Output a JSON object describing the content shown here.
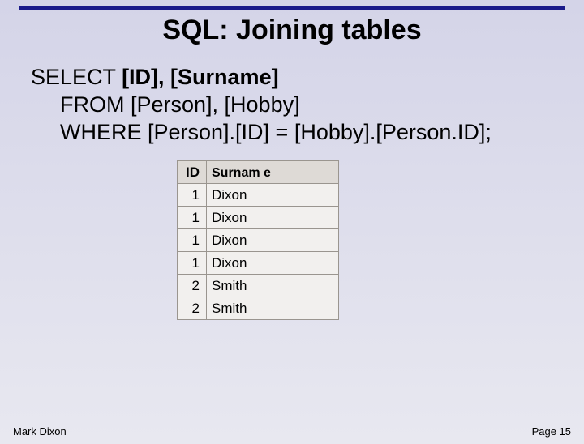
{
  "title": "SQL: Joining tables",
  "sql": {
    "line1_kw": "SELECT ",
    "line1_rest": "[ID], [Surname]",
    "line2": "FROM [Person], [Hobby]",
    "line3": "WHERE [Person].[ID] = [Hobby].[Person.ID];"
  },
  "table": {
    "headers": {
      "id": "ID",
      "surname": "Surnam\ne"
    },
    "rows": [
      {
        "id": "1",
        "surname": "Dixon"
      },
      {
        "id": "1",
        "surname": "Dixon"
      },
      {
        "id": "1",
        "surname": "Dixon"
      },
      {
        "id": "1",
        "surname": "Dixon"
      },
      {
        "id": "2",
        "surname": "Smith"
      },
      {
        "id": "2",
        "surname": "Smith"
      }
    ]
  },
  "footer": {
    "author": "Mark Dixon",
    "page": "Page 15"
  },
  "chart_data": {
    "type": "table",
    "title": "SQL join result",
    "columns": [
      "ID",
      "Surname"
    ],
    "rows": [
      [
        1,
        "Dixon"
      ],
      [
        1,
        "Dixon"
      ],
      [
        1,
        "Dixon"
      ],
      [
        1,
        "Dixon"
      ],
      [
        2,
        "Smith"
      ],
      [
        2,
        "Smith"
      ]
    ]
  }
}
